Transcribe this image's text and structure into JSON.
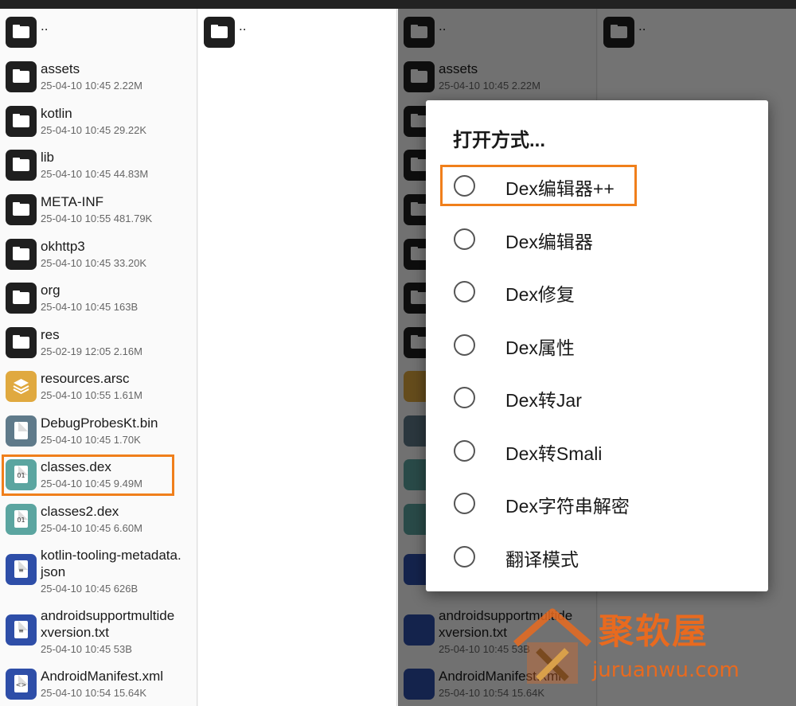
{
  "colors": {
    "highlight": "#f07f1b",
    "watermark": "#e86a1f"
  },
  "parent_dir": "..",
  "files": [
    {
      "icon": "folder-icon",
      "name": "assets",
      "meta": "25-04-10 10:45  2.22M"
    },
    {
      "icon": "folder-icon",
      "name": "kotlin",
      "meta": "25-04-10 10:45  29.22K"
    },
    {
      "icon": "folder-icon",
      "name": "lib",
      "meta": "25-04-10 10:45  44.83M"
    },
    {
      "icon": "folder-icon",
      "name": "META-INF",
      "meta": "25-04-10 10:55  481.79K"
    },
    {
      "icon": "folder-icon",
      "name": "okhttp3",
      "meta": "25-04-10 10:45  33.20K"
    },
    {
      "icon": "folder-icon",
      "name": "org",
      "meta": "25-04-10 10:45  163B"
    },
    {
      "icon": "folder-icon",
      "name": "res",
      "meta": "25-02-19 12:05  2.16M"
    },
    {
      "icon": "layers-icon",
      "name": "resources.arsc",
      "meta": "25-04-10 10:55  1.61M"
    },
    {
      "icon": "file-icon",
      "name": "DebugProbesKt.bin",
      "meta": "25-04-10 10:45  1.70K"
    },
    {
      "icon": "dex-file-icon",
      "name": "classes.dex",
      "meta": "25-04-10 10:45  9.49M"
    },
    {
      "icon": "dex-file-icon",
      "name": "classes2.dex",
      "meta": "25-04-10 10:45  6.60M"
    },
    {
      "icon": "text-file-icon",
      "name_line1": "kotlin-tooling-metadata.",
      "name_line2": "json",
      "meta": "25-04-10 10:45  626B"
    },
    {
      "icon": "text-file-icon",
      "name_line1": "androidsupportmultide",
      "name_line2": "xversion.txt",
      "meta": "25-04-10 10:45  53B"
    },
    {
      "icon": "code-file-icon",
      "name": "AndroidManifest.xml",
      "meta": "25-04-10 10:54  15.64K"
    }
  ],
  "dex_glyph": "01",
  "dialog": {
    "title": "打开方式...",
    "options": [
      "Dex编辑器++",
      "Dex编辑器",
      "Dex修复",
      "Dex属性",
      "Dex转Jar",
      "Dex转Smali",
      "Dex字符串解密",
      "翻译模式"
    ]
  },
  "watermark": {
    "name": "聚软屋",
    "url": "juruanwu.com"
  }
}
